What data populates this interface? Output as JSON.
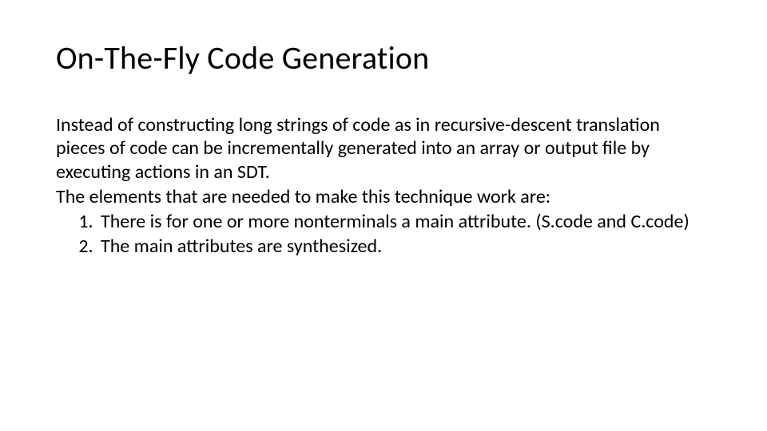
{
  "slide": {
    "title": "On-The-Fly Code Generation",
    "intro": "Instead of constructing long strings of code as in recursive-descent translation pieces of code can be incrementally generated into an array or output file by executing actions in an SDT.",
    "lead": "The elements that are needed to make this technique work are:",
    "items": [
      "There is for one or more nonterminals a main attribute. (S.code and C.code)",
      "The main attributes are synthesized."
    ]
  }
}
